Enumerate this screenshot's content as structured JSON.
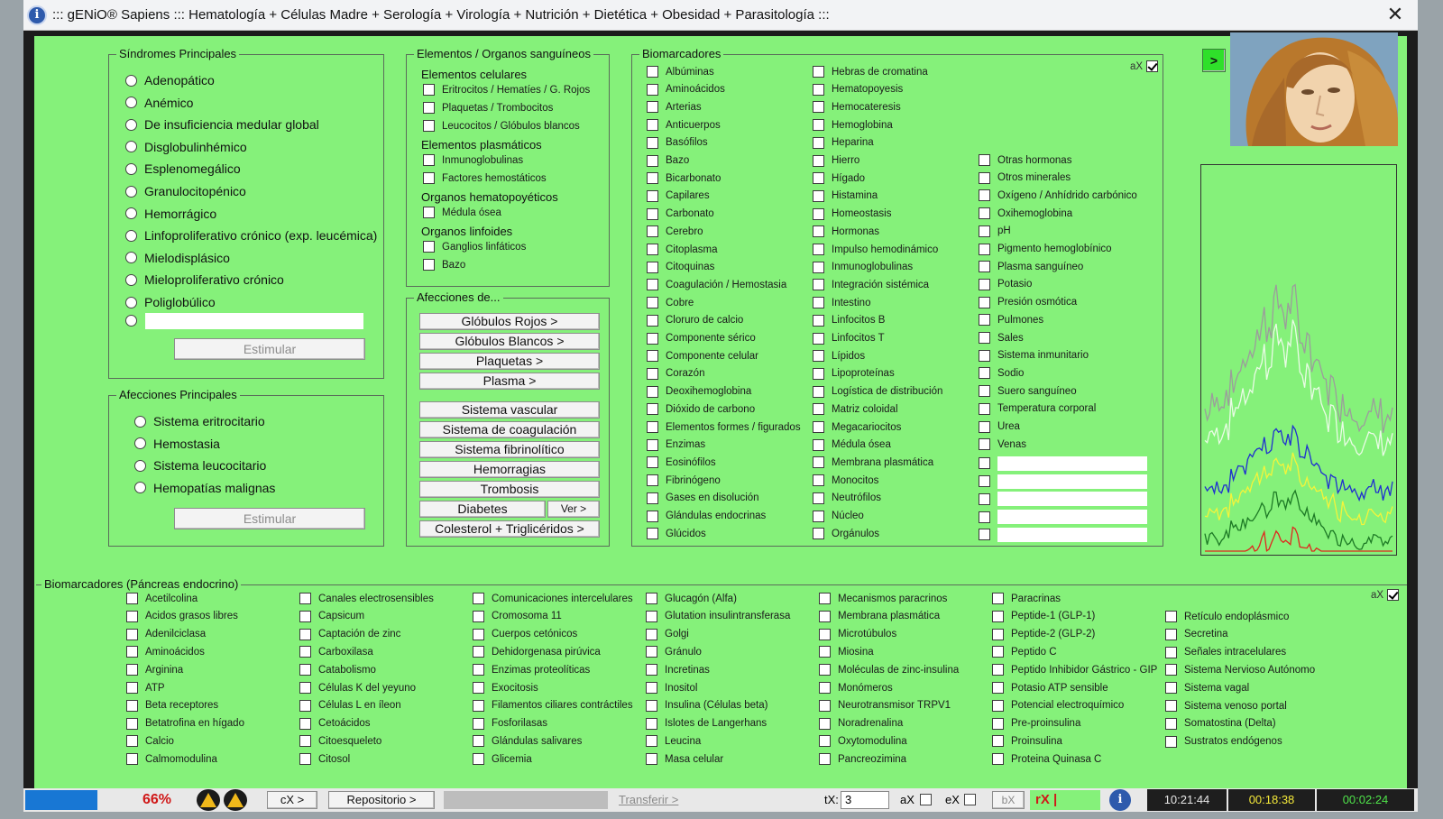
{
  "window": {
    "title": "::: gENiO® Sapiens ::: Hematología + Células Madre + Serología + Virología + Nutrición + Dietética + Obesidad + Parasitología :::",
    "close_glyph": "✕"
  },
  "sindromes": {
    "legend": "Síndromes Principales",
    "options": [
      "Adenopático",
      "Anémico",
      "De insuficiencia medular global",
      "Disglobulinhémico",
      "Esplenomegálico",
      "Granulocitopénico",
      "Hemorrágico",
      "Linfoproliferativo crónico (exp. leucémica)",
      "Mielodisplásico",
      "Mieloproliferativo crónico",
      "Poliglobúlico"
    ],
    "button": "Estimular"
  },
  "afecciones_principales": {
    "legend": "Afecciones Principales",
    "options": [
      "Sistema eritrocitario",
      "Hemostasia",
      "Sistema leucocitario",
      "Hemopatías malignas"
    ],
    "button": "Estimular"
  },
  "elementos": {
    "legend": "Elementos / Organos sanguíneos",
    "groups": [
      {
        "header": "Elementos celulares",
        "items": [
          "Eritrocitos / Hematíes / G. Rojos",
          "Plaquetas / Trombocitos",
          "Leucocitos / Glóbulos blancos"
        ]
      },
      {
        "header": "Elementos plasmáticos",
        "items": [
          "Inmunoglobulinas",
          "Factores hemostáticos"
        ]
      },
      {
        "header": "Organos hematopoyéticos",
        "items": [
          "Médula ósea"
        ]
      },
      {
        "header": "Organos linfoides",
        "items": [
          "Ganglios linfáticos",
          "Bazo"
        ]
      }
    ]
  },
  "afecciones_de": {
    "legend": "Afecciones de...",
    "buttons": [
      "Glóbulos Rojos >",
      "Glóbulos Blancos >",
      "Plaquetas >",
      "Plasma >",
      "Sistema vascular",
      "Sistema de coagulación",
      "Sistema fibrinolítico",
      "Hemorragias",
      "Trombosis",
      "Diabetes",
      "Colesterol + Triglicéridos >"
    ],
    "ver_button": "Ver >"
  },
  "biomarcadores": {
    "legend": "Biomarcadores",
    "ax_label": "aX",
    "ax_checked": true,
    "col1": [
      "Albúminas",
      "Aminoácidos",
      "Arterias",
      "Anticuerpos",
      "Basófilos",
      "Bazo",
      "Bicarbonato",
      "Capilares",
      "Carbonato",
      "Cerebro",
      "Citoplasma",
      "Citoquinas",
      "Coagulación / Hemostasia",
      "Cobre",
      "Cloruro de calcio",
      "Componente sérico",
      "Componente celular",
      "Corazón",
      "Deoxihemoglobina",
      "Dióxido de carbono",
      "Elementos formes / figurados",
      "Enzimas",
      "Eosinófilos",
      "Fibrinógeno",
      "Gases en disolución",
      "Glándulas endocrinas",
      "Glúcidos"
    ],
    "col2": [
      "Hebras de cromatina",
      "Hematopoyesis",
      "Hemocateresis",
      "Hemoglobina",
      "Heparina",
      "Hierro",
      "Hígado",
      "Histamina",
      "Homeostasis",
      "Hormonas",
      "Impulso hemodinámico",
      "Inmunoglobulinas",
      "Integración sistémica",
      "Intestino",
      "Linfocitos B",
      "Linfocitos T",
      "Lípidos",
      "Lipoproteínas",
      "Logística de distribución",
      "Matriz coloidal",
      "Megacariocitos",
      "Médula ósea",
      "Membrana plasmática",
      "Monocitos",
      "Neutrófilos",
      "Núcleo",
      "Orgánulos"
    ],
    "col3": [
      "Otras hormonas",
      "Otros minerales",
      "Oxígeno / Anhídrido carbónico",
      "Oxihemoglobina",
      "pH",
      "Pigmento hemoglobínico",
      "Plasma sanguíneo",
      "Potasio",
      "Presión osmótica",
      "Pulmones",
      "Sales",
      "Sistema inmunitario",
      "Sodio",
      "Suero sanguíneo",
      "Temperatura corporal",
      "Urea",
      "Venas"
    ]
  },
  "go_button": ">",
  "portrait": {
    "alt": "portrait"
  },
  "plot": {
    "series_colors": [
      "#9c9c9c",
      "#eafbe6",
      "#1f2fd0",
      "#f4f43a",
      "#1d7a25",
      "#e0261e"
    ]
  },
  "pancreas": {
    "legend": "Biomarcadores (Páncreas endocrino)",
    "ax_label": "aX",
    "ax_checked": true,
    "columns": [
      [
        "Acetilcolina",
        "Acidos grasos libres",
        "Adenilciclasa",
        "Aminoácidos",
        "Arginina",
        "ATP",
        "Beta receptores",
        "Betatrofina en hígado",
        "Calcio",
        "Calmomodulina"
      ],
      [
        "Canales electrosensibles",
        "Capsicum",
        "Captación de zinc",
        "Carboxilasa",
        "Catabolismo",
        "Células K del yeyuno",
        "Células L en íleon",
        "Cetoácidos",
        "Citoesqueleto",
        "Citosol"
      ],
      [
        "Comunicaciones intercelulares",
        "Cromosoma 11",
        "Cuerpos cetónicos",
        "Dehidorgenasa pirúvica",
        "Enzimas proteolíticas",
        "Exocitosis",
        "Filamentos ciliares contráctiles",
        "Fosforilasas",
        "Glándulas salivares",
        "Glicemia"
      ],
      [
        "Glucagón (Alfa)",
        "Glutation insulintransferasa",
        "Golgi",
        "Gránulo",
        "Incretinas",
        "Inositol",
        "Insulina (Células beta)",
        "Islotes de Langerhans",
        "Leucina",
        "Masa celular"
      ],
      [
        "Mecanismos paracrinos",
        "Membrana plasmática",
        "Microtúbulos",
        "Miosina",
        "Moléculas de zinc-insulina",
        "Monómeros",
        "Neurotransmisor TRPV1",
        "Noradrenalina",
        "Oxytomodulina",
        "Pancreozimina"
      ],
      [
        "Paracrinas",
        "Peptide-1 (GLP-1)",
        "Peptide-2 (GLP-2)",
        "Peptido C",
        "Peptido Inhibidor Gástrico - GIP",
        "Potasio ATP sensible",
        "Potencial electroquímico",
        "Pre-proinsulina",
        "Proinsulina",
        "Proteina Quinasa C"
      ],
      [
        "Retículo endoplásmico",
        "Secretina",
        "Señales intracelulares",
        "Sistema Nervioso Autónomo",
        "Sistema vagal",
        "Sistema venoso portal",
        "Somatostina (Delta)",
        "Sustratos endógenos"
      ]
    ]
  },
  "status": {
    "percent": "66%",
    "cx_button": "cX >",
    "repositorio_button": "Repositorio >",
    "transferir": "Transferir >",
    "tx_label": "tX:",
    "tx_value": "3",
    "ax_label": "aX",
    "ex_label": "eX",
    "bx_label": "bX",
    "rx_label": "rX |",
    "clock1": "10:21:44",
    "clock2": "00:18:38",
    "clock3": "00:02:24"
  }
}
